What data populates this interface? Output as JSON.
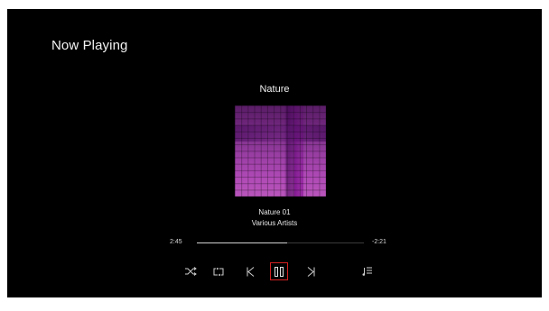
{
  "header": {
    "title": "Now Playing"
  },
  "album": {
    "title": "Nature"
  },
  "track": {
    "name": "Nature 01",
    "artist": "Various Artists"
  },
  "playback": {
    "elapsed": "2:45",
    "remaining": "-2:21",
    "progress": 0.54
  },
  "controls": {
    "items": [
      {
        "name": "shuffle",
        "icon": "shuffle-icon"
      },
      {
        "name": "repeat",
        "icon": "repeat-icon"
      },
      {
        "name": "previous",
        "icon": "skip-previous-icon"
      },
      {
        "name": "pause",
        "icon": "pause-icon",
        "focused": true
      },
      {
        "name": "next",
        "icon": "skip-next-icon"
      },
      {
        "name": "queue",
        "icon": "queue-icon"
      }
    ]
  },
  "colors": {
    "background": "#000000",
    "focus_ring": "#d32020",
    "text": "#f0f0f0",
    "artwork": "#b04ab6"
  }
}
